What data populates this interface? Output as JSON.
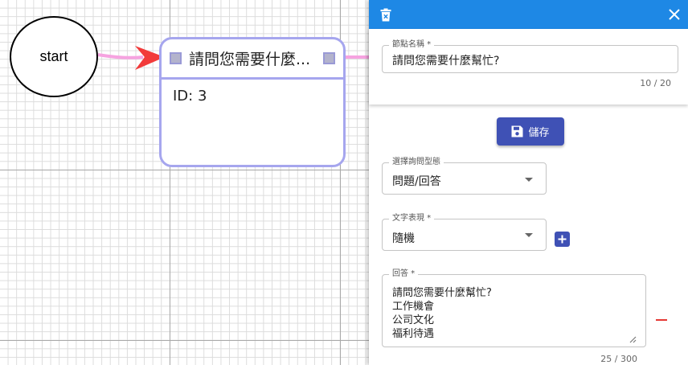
{
  "canvas": {
    "start_node": {
      "label": "start"
    },
    "dialog_node": {
      "title": "請問您需要什麼...",
      "id_text": "ID: 3"
    },
    "colors": {
      "edge": "#f6a3e0",
      "arrow": "#f23a3a",
      "node_border": "#a6a6ee"
    }
  },
  "panel": {
    "header": {
      "delete_icon": "trash-icon",
      "close_icon": "close-icon",
      "color": "#1e88e5"
    },
    "node_name": {
      "label": "節點名稱 *",
      "value": "請問您需要什麼幫忙?",
      "counter": "10 / 20"
    },
    "save_button": {
      "label": "儲存",
      "icon": "save-icon",
      "color": "#3f51b5"
    },
    "query_type": {
      "label": "選擇詢問型態",
      "value": "問題/回答"
    },
    "text_expression": {
      "label": "文字表現 *",
      "value": "隨機",
      "add_icon": "plus-icon"
    },
    "answer": {
      "label": "回答 *",
      "lines": [
        "請問您需要什麼幫忙?",
        "工作機會",
        "公司文化",
        "福利待遇"
      ],
      "counter": "25 / 300",
      "remove_icon": "minus-icon"
    }
  }
}
